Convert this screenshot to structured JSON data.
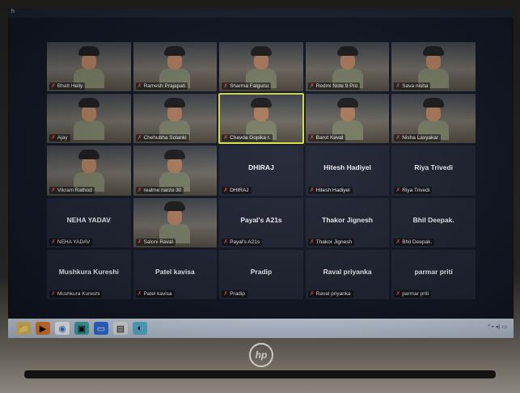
{
  "window": {
    "title_bar_text": "h"
  },
  "participants": [
    {
      "name": "Bhatt Helly",
      "mode": "video"
    },
    {
      "name": "Ramesh Prajapati",
      "mode": "video"
    },
    {
      "name": "Sharma Falgunu",
      "mode": "video"
    },
    {
      "name": "Redmi Note 9 Pro",
      "mode": "video"
    },
    {
      "name": "Sava nisha",
      "mode": "video"
    },
    {
      "name": "Ajay",
      "mode": "video"
    },
    {
      "name": "Chehubha Solanki",
      "mode": "video"
    },
    {
      "name": "Chavda Gopika r.",
      "mode": "video",
      "highlighted": true
    },
    {
      "name": "Barot Keval",
      "mode": "video"
    },
    {
      "name": "Nisha Laxyakar",
      "mode": "video"
    },
    {
      "name": "Vikram Rathod",
      "mode": "video"
    },
    {
      "name": "realme narzo 30",
      "mode": "video"
    },
    {
      "name": "DHIRAJ",
      "display": "DHIRAJ",
      "mode": "name"
    },
    {
      "name": "Hitesh Hadiyel",
      "display": "Hitesh Hadiyel",
      "mode": "name"
    },
    {
      "name": "Riya Trivedi",
      "display": "Riya Trivedi",
      "mode": "name"
    },
    {
      "name": "NEHA YADAV",
      "display": "NEHA YADAV",
      "mode": "name"
    },
    {
      "name": "Saloni Raval",
      "mode": "video"
    },
    {
      "name": "Payal's A21s",
      "display": "Payal's A21s",
      "mode": "name"
    },
    {
      "name": "Thakor Jignesh",
      "display": "Thakor Jignesh",
      "mode": "name"
    },
    {
      "name": "Bhil Deepak.",
      "display": "Bhil Deepak.",
      "mode": "name"
    },
    {
      "name": "Mushkura Kureshi",
      "display": "Mushkura Kureshi",
      "mode": "name"
    },
    {
      "name": "Patel kavisa",
      "display": "Patel kavisa",
      "mode": "name"
    },
    {
      "name": "Pradip",
      "display": "Pradip",
      "mode": "name"
    },
    {
      "name": "Raval priyanka",
      "display": "Raval priyanka",
      "mode": "name"
    },
    {
      "name": "parmar priti",
      "display": "parmar priti",
      "mode": "name"
    }
  ],
  "taskbar": {
    "icons": [
      "windows-explorer-icon",
      "media-player-icon",
      "chrome-icon",
      "photos-icon",
      "zoom-icon",
      "files-icon",
      "edge-icon"
    ]
  },
  "laptop": {
    "brand": "hp"
  },
  "colors": {
    "highlight": "#d7e34a",
    "mic_muted": "#e24a4a",
    "tile_bg": "#1d2231"
  }
}
